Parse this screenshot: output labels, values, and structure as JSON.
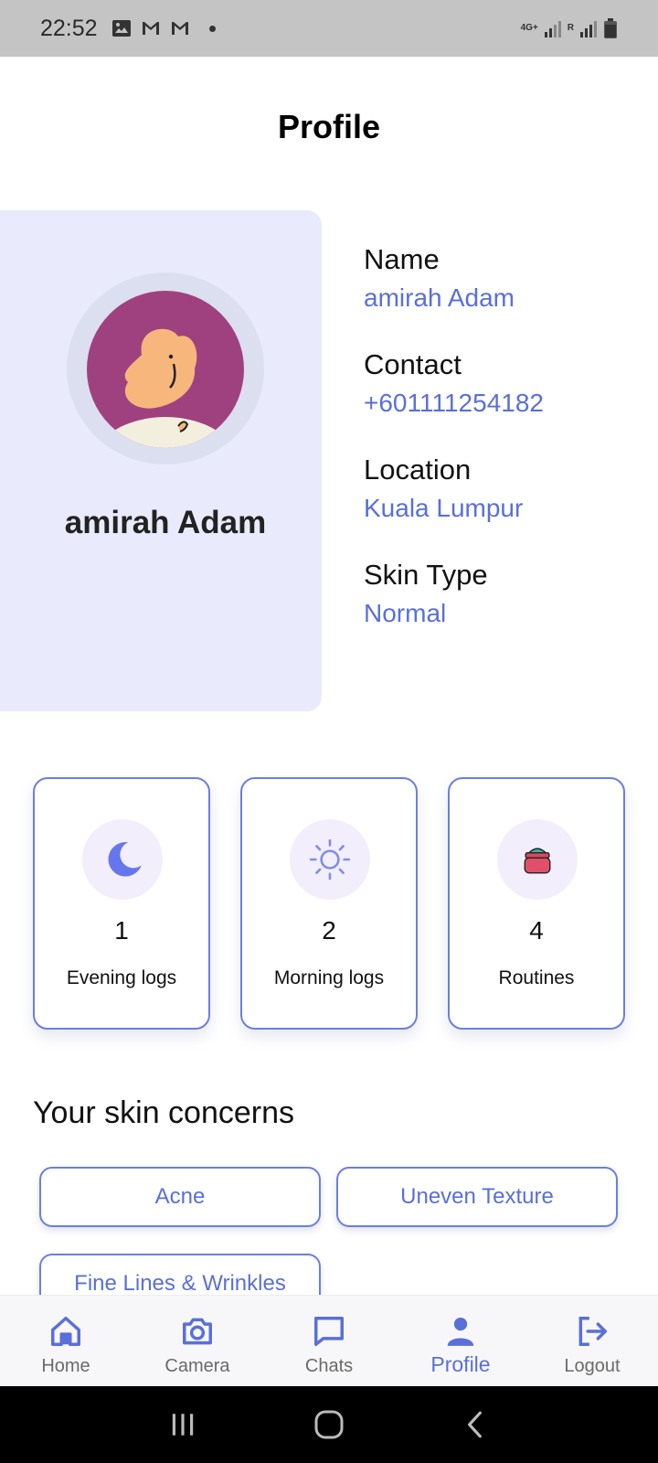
{
  "status_bar": {
    "time": "22:52",
    "network": "4G+",
    "roaming": "R",
    "icons_left": [
      "image-icon",
      "gmail-icon",
      "gmail-icon"
    ],
    "icons_right": [
      "signal-icon",
      "signal-roaming-icon",
      "battery-icon"
    ]
  },
  "header": {
    "title": "Profile"
  },
  "profile": {
    "name": "amirah Adam",
    "fields": [
      {
        "label": "Name",
        "value": "amirah Adam"
      },
      {
        "label": "Contact",
        "value": "+601111254182"
      },
      {
        "label": "Location",
        "value": "Kuala Lumpur"
      },
      {
        "label": "Skin Type",
        "value": "Normal"
      }
    ]
  },
  "stats": [
    {
      "icon": "moon-icon",
      "value": "1",
      "label": "Evening logs"
    },
    {
      "icon": "sun-icon",
      "value": "2",
      "label": "Morning logs"
    },
    {
      "icon": "cream-jar-icon",
      "value": "4",
      "label": "Routines"
    }
  ],
  "concerns": {
    "title": "Your skin concerns",
    "items": [
      "Acne",
      "Uneven Texture",
      "Fine Lines & Wrinkles"
    ]
  },
  "bottom_nav": {
    "items": [
      {
        "label": "Home",
        "icon": "home-icon",
        "active": false
      },
      {
        "label": "Camera",
        "icon": "camera-icon",
        "active": false
      },
      {
        "label": "Chats",
        "icon": "chat-icon",
        "active": false
      },
      {
        "label": "Profile",
        "icon": "person-icon",
        "active": true
      },
      {
        "label": "Logout",
        "icon": "logout-icon",
        "active": false
      }
    ]
  },
  "colors": {
    "accent": "#5a6fd8",
    "card_bg": "#e9ebfc",
    "avatar_bg": "#a0417f"
  }
}
